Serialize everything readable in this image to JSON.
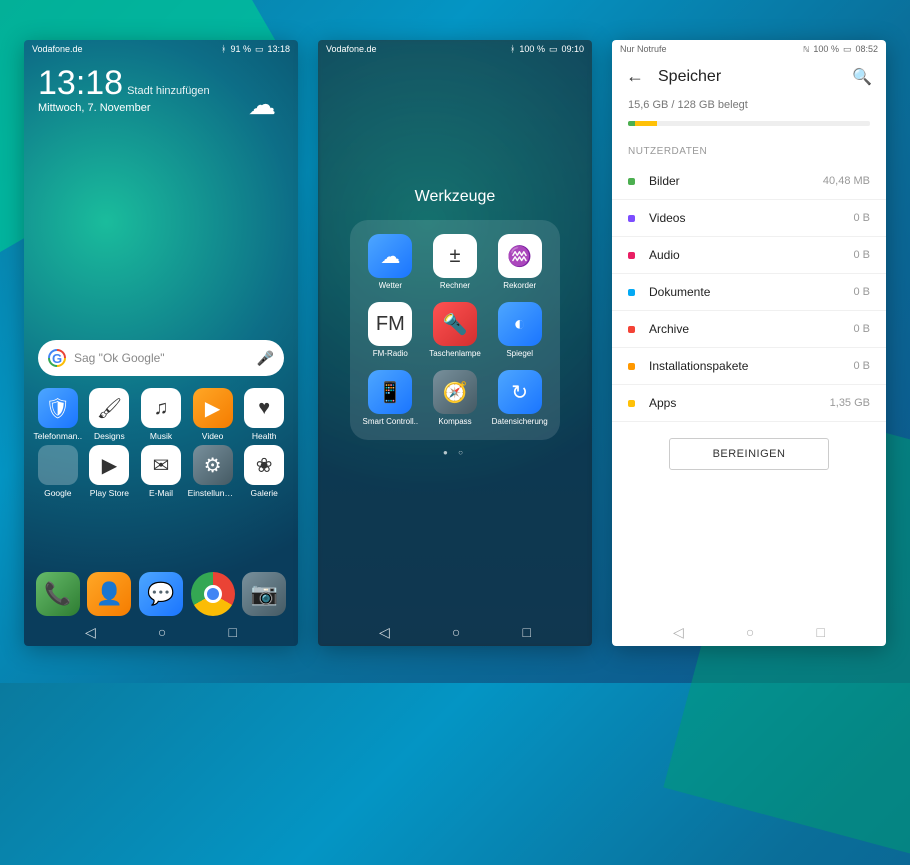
{
  "screen1": {
    "status": {
      "left": "Vodafone.de",
      "battery": "91 %",
      "time": "13:18"
    },
    "clock": {
      "time": "13:18",
      "add_city": "Stadt hinzufügen",
      "date": "Mittwoch, 7. November"
    },
    "search": {
      "placeholder": "Sag \"Ok Google\""
    },
    "apps_r1": [
      {
        "label": "Telefonman..",
        "glyph": "🛡",
        "cls": "bg-blu"
      },
      {
        "label": "Designs",
        "glyph": "🖌",
        "cls": "bg-w"
      },
      {
        "label": "Musik",
        "glyph": "♫",
        "cls": "bg-w"
      },
      {
        "label": "Video",
        "glyph": "▶",
        "cls": "bg-org"
      },
      {
        "label": "Health",
        "glyph": "♥",
        "cls": "bg-w"
      }
    ],
    "apps_r2": [
      {
        "label": "Google",
        "glyph": "",
        "cls": "bg-folder"
      },
      {
        "label": "Play Store",
        "glyph": "▶",
        "cls": "bg-w"
      },
      {
        "label": "E-Mail",
        "glyph": "✉",
        "cls": "bg-w"
      },
      {
        "label": "Einstellungen",
        "glyph": "⚙",
        "cls": "bg-gray"
      },
      {
        "label": "Galerie",
        "glyph": "❀",
        "cls": "bg-w"
      }
    ],
    "dock": [
      {
        "glyph": "📞",
        "cls": "bg-grn"
      },
      {
        "glyph": "👤",
        "cls": "bg-org"
      },
      {
        "glyph": "💬",
        "cls": "bg-blu"
      },
      {
        "glyph": "",
        "cls": "chrome"
      },
      {
        "glyph": "📷",
        "cls": "bg-gray"
      }
    ]
  },
  "screen2": {
    "status": {
      "left": "Vodafone.de",
      "battery": "100 %",
      "time": "09:10"
    },
    "folder_name": "Werkzeuge",
    "apps": [
      {
        "label": "Wetter",
        "glyph": "☁",
        "cls": "bg-blu"
      },
      {
        "label": "Rechner",
        "glyph": "±",
        "cls": "bg-w"
      },
      {
        "label": "Rekorder",
        "glyph": "♒",
        "cls": "bg-w"
      },
      {
        "label": "FM-Radio",
        "glyph": "FM",
        "cls": "bg-w"
      },
      {
        "label": "Taschenlampe",
        "glyph": "🔦",
        "cls": "bg-red"
      },
      {
        "label": "Spiegel",
        "glyph": "◐",
        "cls": "bg-blu"
      },
      {
        "label": "Smart Controll..",
        "glyph": "📱",
        "cls": "bg-blu"
      },
      {
        "label": "Kompass",
        "glyph": "🧭",
        "cls": "bg-gray"
      },
      {
        "label": "Datensicherung",
        "glyph": "↻",
        "cls": "bg-blu"
      }
    ]
  },
  "screen3": {
    "status": {
      "left": "Nur Notrufe",
      "battery": "100 %",
      "time": "08:52"
    },
    "title": "Speicher",
    "usage": "15,6 GB / 128 GB belegt",
    "section": "NUTZERDATEN",
    "items": [
      {
        "name": "Bilder",
        "val": "40,48 MB",
        "color": "#4caf50"
      },
      {
        "name": "Videos",
        "val": "0 B",
        "color": "#7c4dff"
      },
      {
        "name": "Audio",
        "val": "0 B",
        "color": "#e91e63"
      },
      {
        "name": "Dokumente",
        "val": "0 B",
        "color": "#03a9f4"
      },
      {
        "name": "Archive",
        "val": "0 B",
        "color": "#f44336"
      },
      {
        "name": "Installationspakete",
        "val": "0 B",
        "color": "#ff9800"
      },
      {
        "name": "Apps",
        "val": "1,35 GB",
        "color": "#ffc107"
      }
    ],
    "button": "BEREINIGEN"
  }
}
